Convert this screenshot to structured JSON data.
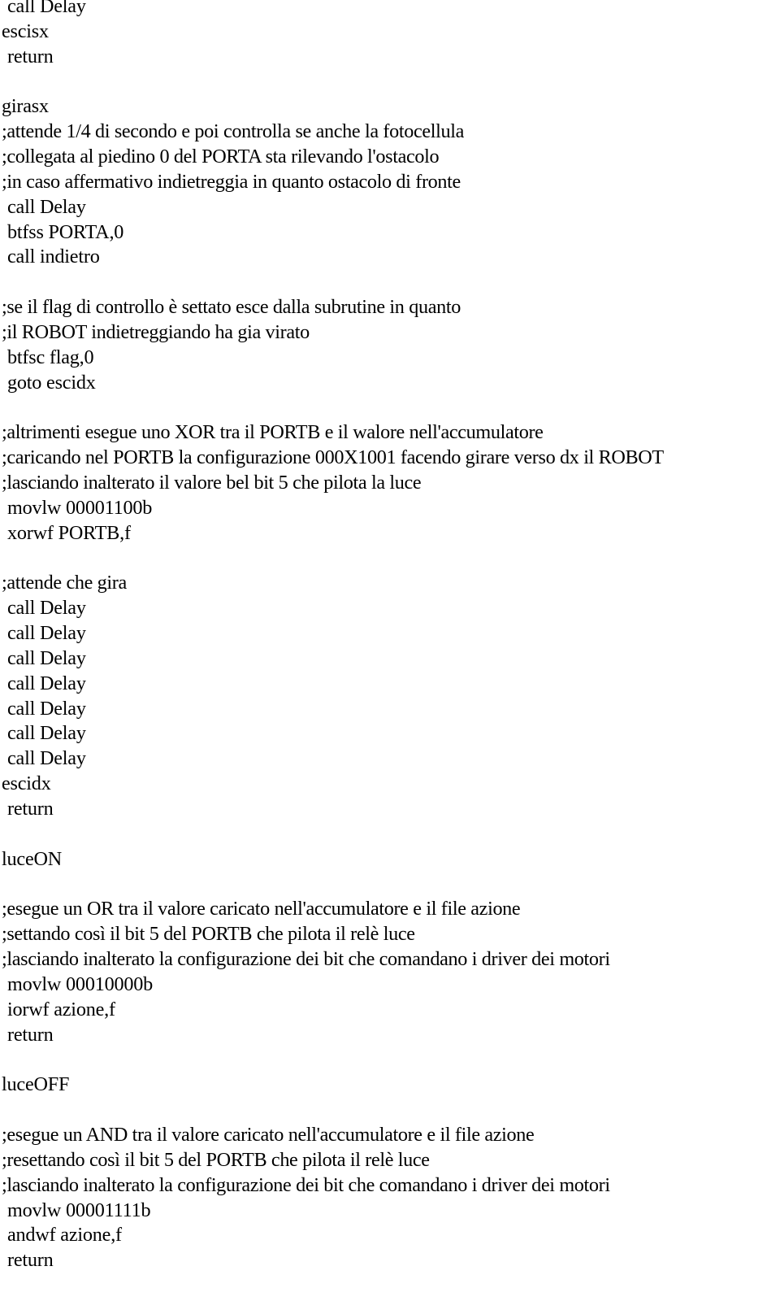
{
  "document": {
    "lines": [
      {
        "text": "call Delay",
        "kind": "instruction"
      },
      {
        "text": "escisx",
        "kind": "label"
      },
      {
        "text": "return",
        "kind": "instruction"
      },
      {
        "text": "",
        "kind": "blank"
      },
      {
        "text": "girasx",
        "kind": "label"
      },
      {
        "text": ";attende 1/4 di secondo e poi controlla se anche la fotocellula",
        "kind": "comment"
      },
      {
        "text": ";collegata al piedino 0 del PORTA sta rilevando l'ostacolo",
        "kind": "comment"
      },
      {
        "text": ";in caso affermativo indietreggia in quanto ostacolo di fronte",
        "kind": "comment"
      },
      {
        "text": "call Delay",
        "kind": "instruction"
      },
      {
        "text": "btfss PORTA,0",
        "kind": "instruction"
      },
      {
        "text": "call indietro",
        "kind": "instruction"
      },
      {
        "text": "",
        "kind": "blank"
      },
      {
        "text": ";se il flag di controllo è settato esce dalla subrutine in quanto",
        "kind": "comment"
      },
      {
        "text": ";il ROBOT indietreggiando ha gia virato",
        "kind": "comment"
      },
      {
        "text": "btfsc flag,0",
        "kind": "instruction"
      },
      {
        "text": "goto escidx",
        "kind": "instruction"
      },
      {
        "text": "",
        "kind": "blank"
      },
      {
        "text": ";altrimenti esegue uno XOR tra il PORTB e il walore nell'accumulatore",
        "kind": "comment"
      },
      {
        "text": ";caricando nel PORTB la configurazione 000X1001 facendo girare verso dx il ROBOT",
        "kind": "comment"
      },
      {
        "text": ";lasciando inalterato il valore bel bit 5 che pilota la luce",
        "kind": "comment"
      },
      {
        "text": "movlw 00001100b",
        "kind": "instruction"
      },
      {
        "text": "xorwf PORTB,f",
        "kind": "instruction"
      },
      {
        "text": "",
        "kind": "blank"
      },
      {
        "text": ";attende che gira",
        "kind": "comment"
      },
      {
        "text": "call Delay",
        "kind": "instruction"
      },
      {
        "text": "call Delay",
        "kind": "instruction"
      },
      {
        "text": "call Delay",
        "kind": "instruction"
      },
      {
        "text": "call Delay",
        "kind": "instruction"
      },
      {
        "text": "call Delay",
        "kind": "instruction"
      },
      {
        "text": "call Delay",
        "kind": "instruction"
      },
      {
        "text": "call Delay",
        "kind": "instruction"
      },
      {
        "text": "escidx",
        "kind": "label"
      },
      {
        "text": "return",
        "kind": "instruction"
      },
      {
        "text": "",
        "kind": "blank"
      },
      {
        "text": "luceON",
        "kind": "label"
      },
      {
        "text": "",
        "kind": "blank"
      },
      {
        "text": ";esegue un OR tra il valore caricato nell'accumulatore e il file azione",
        "kind": "comment"
      },
      {
        "text": ";settando così il bit 5 del PORTB che pilota il relè luce",
        "kind": "comment"
      },
      {
        "text": ";lasciando inalterato la configurazione dei bit che comandano i driver dei motori",
        "kind": "comment"
      },
      {
        "text": "movlw 00010000b",
        "kind": "instruction"
      },
      {
        "text": "iorwf azione,f",
        "kind": "instruction"
      },
      {
        "text": "return",
        "kind": "instruction"
      },
      {
        "text": "",
        "kind": "blank"
      },
      {
        "text": "luceOFF",
        "kind": "label"
      },
      {
        "text": "",
        "kind": "blank"
      },
      {
        "text": ";esegue un AND tra il valore caricato nell'accumulatore e il file azione",
        "kind": "comment"
      },
      {
        "text": ";resettando così il bit 5 del PORTB che pilota il relè luce",
        "kind": "comment"
      },
      {
        "text": ";lasciando inalterato la configurazione dei bit che comandano i driver dei motori",
        "kind": "comment"
      },
      {
        "text": "movlw 00001111b",
        "kind": "instruction"
      },
      {
        "text": "andwf azione,f",
        "kind": "instruction"
      },
      {
        "text": "return",
        "kind": "instruction"
      }
    ]
  }
}
